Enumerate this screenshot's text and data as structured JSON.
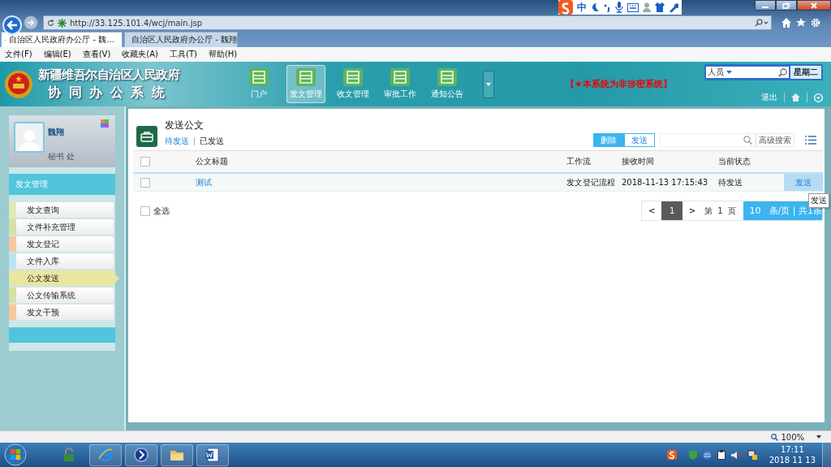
{
  "browser": {
    "ime": "中",
    "address": "http://33.125.101.4/wcj/main.jsp",
    "tabs": [
      {
        "title": "自治区人民政府办公厅 - 魏...",
        "selected": true
      },
      {
        "title": "自治区人民政府办公厅 - 魏翔",
        "selected": false
      }
    ],
    "menu": [
      "文件(F)",
      "编辑(E)",
      "查看(V)",
      "收藏夹(A)",
      "工具(T)",
      "帮助(H)"
    ],
    "zoom": "100%"
  },
  "app": {
    "title": "新疆维吾尔自治区人民政府",
    "subtitle": "协 同 办 公 系 统",
    "nav": [
      {
        "label": "门户",
        "selected": false
      },
      {
        "label": "发文管理",
        "selected": true
      },
      {
        "label": "收文管理",
        "selected": false
      },
      {
        "label": "审批工作",
        "selected": false
      },
      {
        "label": "通知公告",
        "selected": false
      }
    ],
    "notice": "【★本系统为非涉密系统】",
    "search_scope": "人员",
    "weekday": "星期二",
    "logout": "退出"
  },
  "sidebar": {
    "user": {
      "name": "魏翔",
      "dept": "秘书 处"
    },
    "section": "发文管理",
    "items": [
      {
        "label": "发文查询",
        "color": "#e3e9b0",
        "selected": false
      },
      {
        "label": "文件补充管理",
        "color": "#d3e2a4",
        "selected": false
      },
      {
        "label": "发文登记",
        "color": "#f6c8a0",
        "selected": false
      },
      {
        "label": "文件入库",
        "color": "#bfe2f2",
        "selected": false
      },
      {
        "label": "公文发送",
        "color": "#e9e6a2",
        "selected": true
      },
      {
        "label": "公文传输系统",
        "color": "#d3e2a4",
        "selected": false
      },
      {
        "label": "发文干预",
        "color": "#f6c8a0",
        "selected": false
      }
    ]
  },
  "main": {
    "title": "发送公文",
    "tabs": [
      {
        "label": "待发送",
        "selected": true
      },
      {
        "label": "已发送",
        "selected": false
      }
    ],
    "actions": [
      {
        "label": "删除",
        "kind": "primary"
      },
      {
        "label": "发送",
        "kind": "outline"
      }
    ],
    "advanced_search": "高级搜索",
    "table": {
      "header_checked": false,
      "columns": [
        "公文标题",
        "工作流",
        "接收时间",
        "当前状态"
      ],
      "rows": [
        {
          "checked": false,
          "title": "测试",
          "workflow": "发文登记流程",
          "received": "2018-11-13 17:15:43",
          "status": "待发送",
          "action": "发送"
        }
      ]
    },
    "select_all": {
      "label": "全选",
      "checked": false
    },
    "tooltip": "发送",
    "pagination": {
      "prev": "<",
      "pages": [
        {
          "label": "1",
          "selected": true
        }
      ],
      "next": ">",
      "page_prefix": "第",
      "page": "1",
      "page_suffix": "页",
      "page_size": "10",
      "summary": "条/页 | 共1条"
    }
  },
  "taskbar": {
    "time": "17:11",
    "date": "2018 11 13"
  }
}
